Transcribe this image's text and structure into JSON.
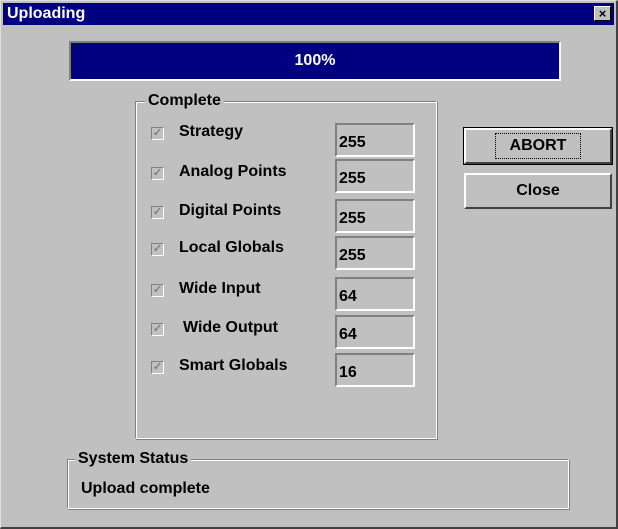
{
  "window": {
    "title": "Uploading",
    "close_label": "×"
  },
  "progress": {
    "value": 1.0,
    "label": "100%",
    "fill_color": "#000080"
  },
  "complete_group": {
    "label": "Complete",
    "items": [
      {
        "label": "Strategy",
        "value": "255",
        "checked": true
      },
      {
        "label": "Analog Points",
        "value": "255",
        "checked": true
      },
      {
        "label": "Digital Points",
        "value": "255",
        "checked": true
      },
      {
        "label": "Local Globals",
        "value": "255",
        "checked": true
      },
      {
        "label": "Wide Input",
        "value": "64",
        "checked": true
      },
      {
        "label": "Wide Output",
        "value": "64",
        "checked": true
      },
      {
        "label": "Smart Globals",
        "value": "16",
        "checked": true
      }
    ]
  },
  "buttons": {
    "abort_label": "ABORT",
    "close_label": "Close"
  },
  "system_status": {
    "label": "System Status",
    "text": "Upload complete"
  },
  "icons": {
    "checkbox": "checkmark-icon",
    "close": "close-icon"
  }
}
